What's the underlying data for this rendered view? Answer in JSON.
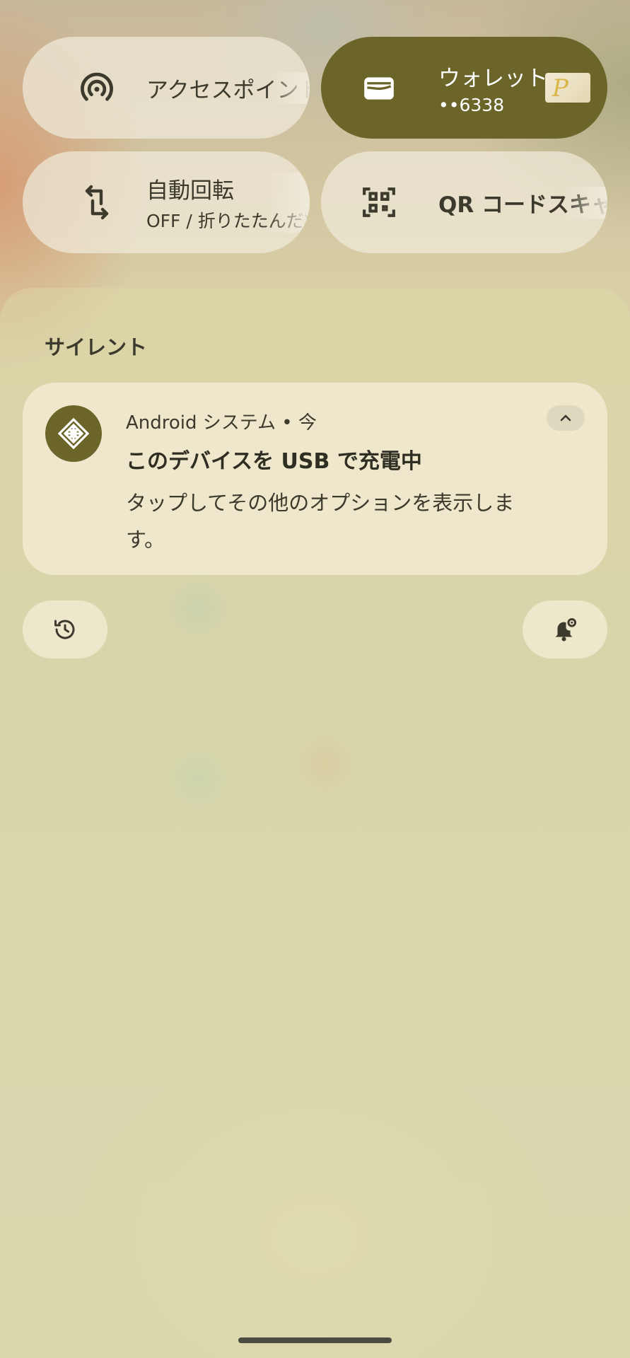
{
  "quick_tiles": [
    {
      "label": "アクセスポイント",
      "sublabel": "",
      "icon": "hotspot-icon",
      "active": false
    },
    {
      "label": "ウォレット",
      "sublabel": "••6338",
      "icon": "wallet-icon",
      "active": true
    },
    {
      "label": "自動回転",
      "sublabel": "OFF / 折りたたんだ状",
      "icon": "screen-rotation-icon",
      "active": false
    },
    {
      "label": "QR コードスキャナー",
      "sublabel": "",
      "icon": "qr-code-scanner-icon",
      "active": false
    }
  ],
  "notifications": {
    "section_title": "サイレント",
    "items": [
      {
        "header": "Android システム • 今",
        "title": "このデバイスを USB で充電中",
        "body": "タップしてその他のオプションを表示します。",
        "icon": "android-system-icon"
      }
    ]
  },
  "footer": {
    "history_icon": "history-icon",
    "settings_icon": "notification-settings-icon"
  },
  "colors": {
    "accent": "#6b652a",
    "tile_bg": "#efe9d9",
    "text": "#3b3a2c"
  }
}
